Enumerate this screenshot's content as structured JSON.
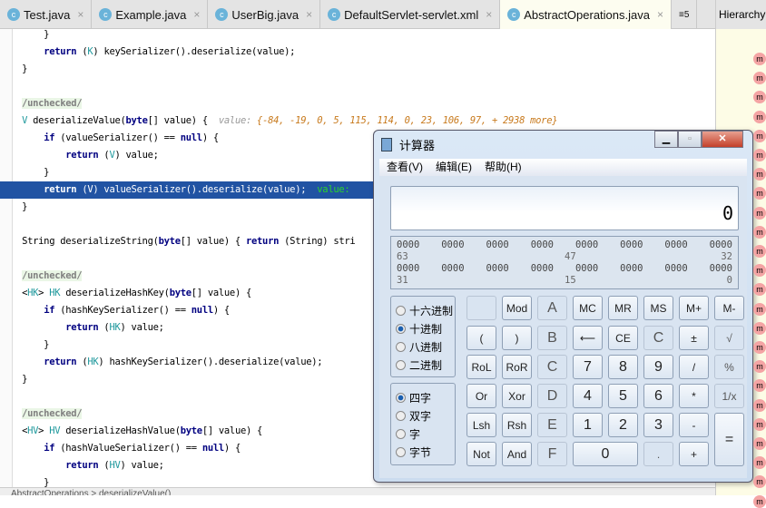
{
  "tabs": [
    {
      "label": "Test.java"
    },
    {
      "label": "Example.java"
    },
    {
      "label": "UserBig.java"
    },
    {
      "label": "DefaultServlet-servlet.xml"
    },
    {
      "label": "AbstractOperations.java",
      "active": true
    }
  ],
  "tab_overflow": "≡5",
  "hierarchy_title": "Hierarchy",
  "code": [
    [
      [
        "",
        "        }"
      ]
    ],
    [
      [
        "",
        "        "
      ],
      [
        "kw",
        "return"
      ],
      [
        "",
        " ("
      ],
      [
        "ty",
        "K"
      ],
      [
        "",
        ") keySerializer().deserialize(value);"
      ]
    ],
    [
      [
        "",
        "    }"
      ]
    ],
    [],
    [
      [
        "",
        "    "
      ],
      [
        "cm",
        "/unchecked/"
      ]
    ],
    [
      [
        "",
        "    "
      ],
      [
        "ty",
        "V"
      ],
      [
        "",
        " deserializeValue("
      ],
      [
        "kw",
        "byte"
      ],
      [
        "",
        "[] value) {  "
      ],
      [
        "hint",
        "value: "
      ],
      [
        "hv",
        "{-84, -19, 0, 5, 115, 114, 0, 23, 106, 97, + 2938 more}"
      ]
    ],
    [
      [
        "",
        "        "
      ],
      [
        "kw",
        "if"
      ],
      [
        "",
        " (valueSerializer() == "
      ],
      [
        "kw",
        "null"
      ],
      [
        "",
        ") {"
      ]
    ],
    [
      [
        "",
        "            "
      ],
      [
        "kw",
        "return"
      ],
      [
        "",
        " ("
      ],
      [
        "ty",
        "V"
      ],
      [
        "",
        ") value;"
      ]
    ],
    [
      [
        "",
        "        }"
      ]
    ],
    [
      [
        "",
        "        "
      ],
      [
        "kw",
        "return"
      ],
      [
        "",
        " (V) valueSerializer().deserialize(value);  "
      ],
      [
        "hg",
        "value:"
      ]
    ],
    [
      [
        "",
        "    }"
      ]
    ],
    [],
    [
      [
        "",
        "    String deserializeString("
      ],
      [
        "kw",
        "byte"
      ],
      [
        "",
        "[] value) { "
      ],
      [
        "kw",
        "return"
      ],
      [
        "",
        " (String) stri"
      ]
    ],
    [],
    [
      [
        "",
        "    "
      ],
      [
        "cm",
        "/unchecked/"
      ]
    ],
    [
      [
        "",
        "    <"
      ],
      [
        "ty",
        "HK"
      ],
      [
        "",
        "> "
      ],
      [
        "ty",
        "HK"
      ],
      [
        "",
        " deserializeHashKey("
      ],
      [
        "kw",
        "byte"
      ],
      [
        "",
        "[] value) {"
      ]
    ],
    [
      [
        "",
        "        "
      ],
      [
        "kw",
        "if"
      ],
      [
        "",
        " (hashKeySerializer() == "
      ],
      [
        "kw",
        "null"
      ],
      [
        "",
        ") {"
      ]
    ],
    [
      [
        "",
        "            "
      ],
      [
        "kw",
        "return"
      ],
      [
        "",
        " ("
      ],
      [
        "ty",
        "HK"
      ],
      [
        "",
        ") value;"
      ]
    ],
    [
      [
        "",
        "        }"
      ]
    ],
    [
      [
        "",
        "        "
      ],
      [
        "kw",
        "return"
      ],
      [
        "",
        " ("
      ],
      [
        "ty",
        "HK"
      ],
      [
        "",
        ") hashKeySerializer().deserialize(value);"
      ]
    ],
    [
      [
        "",
        "    }"
      ]
    ],
    [],
    [
      [
        "",
        "    "
      ],
      [
        "cm",
        "/unchecked/"
      ]
    ],
    [
      [
        "",
        "    <"
      ],
      [
        "ty",
        "HV"
      ],
      [
        "",
        "> "
      ],
      [
        "ty",
        "HV"
      ],
      [
        "",
        " deserializeHashValue("
      ],
      [
        "kw",
        "byte"
      ],
      [
        "",
        "[] value) {"
      ]
    ],
    [
      [
        "",
        "        "
      ],
      [
        "kw",
        "if"
      ],
      [
        "",
        " (hashValueSerializer() == "
      ],
      [
        "kw",
        "null"
      ],
      [
        "",
        ") {"
      ]
    ],
    [
      [
        "",
        "            "
      ],
      [
        "kw",
        "return"
      ],
      [
        "",
        " ("
      ],
      [
        "ty",
        "HV"
      ],
      [
        "",
        ") value;"
      ]
    ],
    [
      [
        "",
        "        }"
      ]
    ]
  ],
  "highlight_line": 9,
  "status": "AbstractOperations > deserializeValue()",
  "calc": {
    "title": "计算器",
    "menu": [
      "查看(V)",
      "编辑(E)",
      "帮助(H)"
    ],
    "display": "0",
    "bits_rows": [
      {
        "groups": [
          "0000",
          "0000",
          "0000",
          "0000",
          "0000",
          "0000",
          "0000",
          "0000"
        ],
        "labels": [
          "63",
          "47",
          "32"
        ]
      },
      {
        "groups": [
          "0000",
          "0000",
          "0000",
          "0000",
          "0000",
          "0000",
          "0000",
          "0000"
        ],
        "labels": [
          "31",
          "15",
          "0"
        ]
      }
    ],
    "base_options": [
      {
        "label": "十六进制"
      },
      {
        "label": "十进制",
        "on": true
      },
      {
        "label": "八进制"
      },
      {
        "label": "二进制"
      }
    ],
    "word_options": [
      {
        "label": "四字",
        "on": true
      },
      {
        "label": "双字"
      },
      {
        "label": "字"
      },
      {
        "label": "字节"
      }
    ],
    "buttons": [
      [
        "",
        "Mod",
        "A",
        "MC",
        "MR",
        "MS",
        "M+",
        "M-"
      ],
      [
        "(",
        ")",
        "B",
        "⟵",
        "CE",
        "C",
        "±",
        "√"
      ],
      [
        "RoL",
        "RoR",
        "C",
        "7",
        "8",
        "9",
        "/",
        "%"
      ],
      [
        "Or",
        "Xor",
        "D",
        "4",
        "5",
        "6",
        "*",
        "1/x"
      ],
      [
        "Lsh",
        "Rsh",
        "E",
        "1",
        "2",
        "3",
        "-",
        "="
      ],
      [
        "Not",
        "And",
        "F",
        "0",
        "",
        ".",
        "+",
        ""
      ]
    ]
  }
}
